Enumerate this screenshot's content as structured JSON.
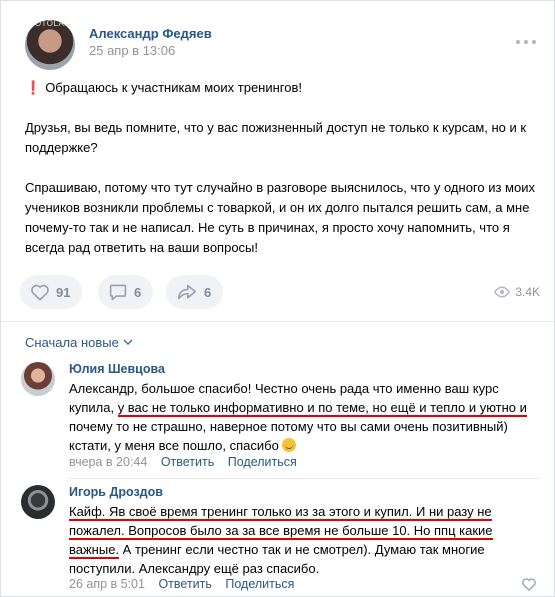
{
  "post": {
    "avatar_watermark": "SOTOLAB",
    "author": "Александр Федяев",
    "date": "25 апр в 13:06",
    "text": [
      "Обращаюсь к участникам моих тренингов!",
      "Друзья, вы ведь помните, что у вас пожизненный доступ не только к курсам, но и к поддержке?",
      "Спрашиваю, потому что тут случайно в разговоре выяснилось, что у одного из моих учеников возникли проблемы с товаркой, и он их долго пытался решить сам, а мне почему-то так и не написал. Не суть в причинах, я просто хочу напомнить, что я всегда рад ответить на ваши вопросы!"
    ],
    "likes": "91",
    "comments": "6",
    "shares": "6",
    "views": "3.4K"
  },
  "sort_label": "Сначала новые",
  "comments": [
    {
      "author": "Юлия Шевцова",
      "text_parts": [
        "Александр, большое спасибо! Честно очень рада что именно ваш курс купила, ",
        "у вас не только информативно и по теме, но ещё и тепло и уютно и",
        " почему то не страшно, наверное потому что вы сами очень позитивный) кстати, у меня все пошло, спасибо "
      ],
      "time": "вчера в 20:44",
      "reply": "Ответить",
      "share": "Поделиться"
    },
    {
      "author": "Игорь Дроздов",
      "text_parts": [
        "Кайф. Яв своё время тренинг только из за этого и купил. И ни разу не пожалел. Вопросов было за за все время не больше 10. Но ппц какие важные.",
        " А тренинг если честно так и не смотрел). Думаю так многие поступили. Александру ещё раз спасибо."
      ],
      "time": "26 апр в 5:01",
      "reply": "Ответить",
      "share": "Поделиться"
    }
  ],
  "icons": [
    "more-icon",
    "heart-icon",
    "comment-icon",
    "share-icon",
    "eye-icon",
    "chevron-down-icon",
    "exclamation-icon",
    "smile-emoji-icon",
    "heart-small-icon"
  ],
  "colors": {
    "link": "#2a5885",
    "muted": "#939393",
    "underline": "#e60000",
    "accent": "#e64646"
  }
}
